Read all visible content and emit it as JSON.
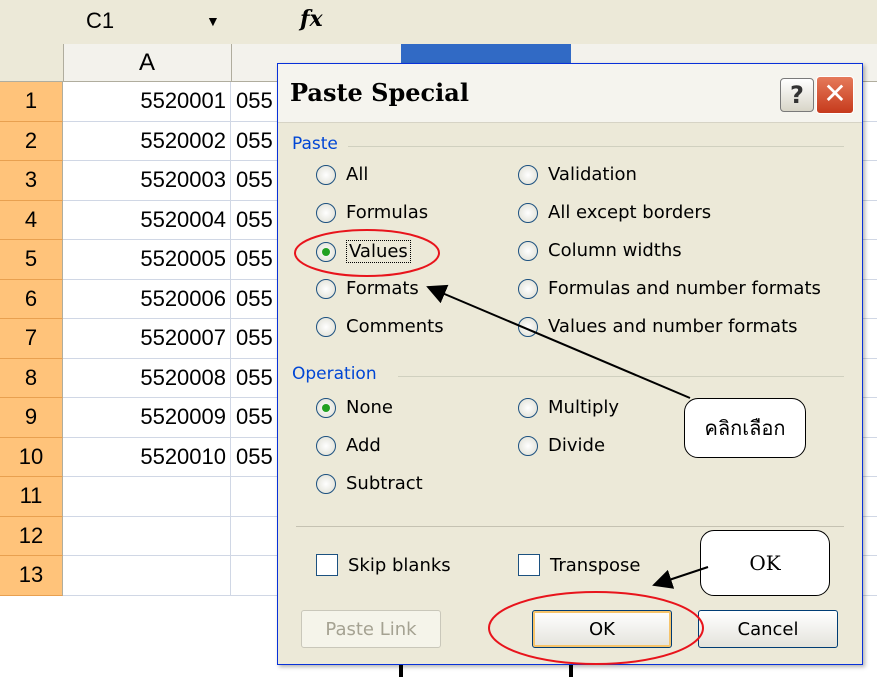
{
  "formula_bar": {
    "cell_ref": "C1",
    "fx_symbol": "fx"
  },
  "columns": [
    "A"
  ],
  "rows": [
    {
      "num": "1",
      "a": "5520001",
      "b": "055"
    },
    {
      "num": "2",
      "a": "5520002",
      "b": "055"
    },
    {
      "num": "3",
      "a": "5520003",
      "b": "055"
    },
    {
      "num": "4",
      "a": "5520004",
      "b": "055"
    },
    {
      "num": "5",
      "a": "5520005",
      "b": "055"
    },
    {
      "num": "6",
      "a": "5520006",
      "b": "055"
    },
    {
      "num": "7",
      "a": "5520007",
      "b": "055"
    },
    {
      "num": "8",
      "a": "5520008",
      "b": "055"
    },
    {
      "num": "9",
      "a": "5520009",
      "b": "055"
    },
    {
      "num": "10",
      "a": "5520010",
      "b": "055"
    },
    {
      "num": "11",
      "a": "",
      "b": ""
    },
    {
      "num": "12",
      "a": "",
      "b": ""
    },
    {
      "num": "13",
      "a": "",
      "b": ""
    }
  ],
  "dialog": {
    "title": "Paste Special",
    "help_label": "?",
    "close_label": "✕",
    "paste_group": "Paste",
    "paste_left": [
      {
        "label": "All",
        "checked": false
      },
      {
        "label": "Formulas",
        "checked": false
      },
      {
        "label": "Values",
        "checked": true
      },
      {
        "label": "Formats",
        "checked": false
      },
      {
        "label": "Comments",
        "checked": false
      }
    ],
    "paste_right": [
      {
        "label": "Validation",
        "checked": false
      },
      {
        "label": "All except borders",
        "checked": false
      },
      {
        "label": "Column widths",
        "checked": false
      },
      {
        "label": "Formulas and number formats",
        "checked": false
      },
      {
        "label": "Values and number formats",
        "checked": false
      }
    ],
    "operation_group": "Operation",
    "operation_left": [
      {
        "label": "None",
        "checked": true
      },
      {
        "label": "Add",
        "checked": false
      },
      {
        "label": "Subtract",
        "checked": false
      }
    ],
    "operation_right": [
      {
        "label": "Multiply",
        "checked": false
      },
      {
        "label": "Divide",
        "checked": false
      }
    ],
    "skip_blanks": "Skip blanks",
    "transpose": "Transpose",
    "paste_link": "Paste Link",
    "ok": "OK",
    "cancel": "Cancel"
  },
  "annotations": {
    "click_select": "คลิกเลือก",
    "ok_callout": "OK",
    "highlight_color": "#e8141c"
  }
}
